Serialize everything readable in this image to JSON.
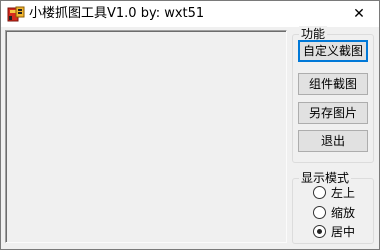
{
  "window": {
    "title": "小楼抓图工具V1.0   by:  wxt51",
    "close_glyph": "✕"
  },
  "functions": {
    "legend": "功能",
    "buttons": [
      {
        "label": "自定义截图",
        "focused": true
      },
      {
        "label": "组件截图",
        "focused": false
      },
      {
        "label": "另存图片",
        "focused": false
      },
      {
        "label": "退出",
        "focused": false
      }
    ]
  },
  "display_mode": {
    "legend": "显示模式",
    "options": [
      {
        "label": "左上",
        "checked": false
      },
      {
        "label": "缩放",
        "checked": false
      },
      {
        "label": "居中",
        "checked": true
      }
    ]
  },
  "colors": {
    "accent": "#0078d7",
    "window_bg": "#f0f0f0",
    "titlebar_bg": "#ffffff"
  }
}
